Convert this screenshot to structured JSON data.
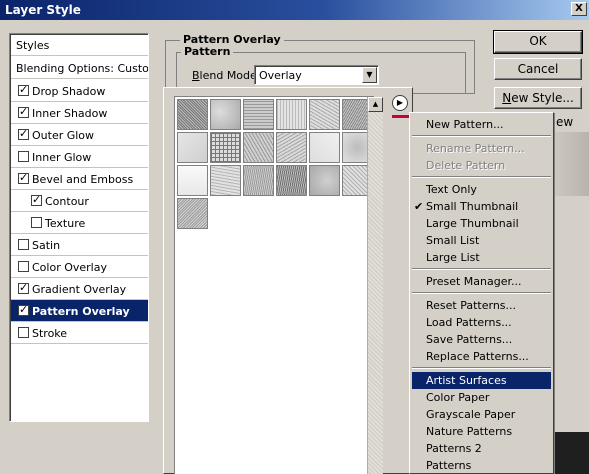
{
  "window": {
    "title": "Layer Style",
    "close_glyph": "X"
  },
  "styles_list": {
    "header": "Styles",
    "blending_options": "Blending Options: Custom",
    "items": [
      {
        "label": "Drop Shadow",
        "checked": true
      },
      {
        "label": "Inner Shadow",
        "checked": true
      },
      {
        "label": "Outer Glow",
        "checked": true
      },
      {
        "label": "Inner Glow",
        "checked": false
      },
      {
        "label": "Bevel and Emboss",
        "checked": true
      },
      {
        "label": "Contour",
        "checked": true,
        "indent": true
      },
      {
        "label": "Texture",
        "checked": false,
        "indent": true
      },
      {
        "label": "Satin",
        "checked": false
      },
      {
        "label": "Color Overlay",
        "checked": false
      },
      {
        "label": "Gradient Overlay",
        "checked": true
      },
      {
        "label": "Pattern Overlay",
        "checked": true,
        "selected": true
      },
      {
        "label": "Stroke",
        "checked": false
      }
    ]
  },
  "pattern_overlay": {
    "title": "Pattern Overlay",
    "group_title": "Pattern",
    "blend_mode_label": "lend Mode:",
    "blend_mode_accel": "B",
    "blend_mode_value": "Overlay"
  },
  "buttons": {
    "ok": "OK",
    "cancel": "Cancel",
    "new_style": "New Style...",
    "new_style_accel": "N",
    "new_style_rest": "ew Style..."
  },
  "preview": {
    "label": "ew"
  },
  "picker": {
    "tile_count": 19
  },
  "menu": {
    "items": [
      {
        "label": "New Pattern...",
        "state": "normal"
      },
      {
        "sep": true
      },
      {
        "label": "Rename Pattern...",
        "state": "disabled"
      },
      {
        "label": "Delete Pattern",
        "state": "disabled"
      },
      {
        "sep": true
      },
      {
        "label": "Text Only",
        "state": "normal"
      },
      {
        "label": "Small Thumbnail",
        "state": "checked"
      },
      {
        "label": "Large Thumbnail",
        "state": "normal"
      },
      {
        "label": "Small List",
        "state": "normal"
      },
      {
        "label": "Large List",
        "state": "normal"
      },
      {
        "sep": true
      },
      {
        "label": "Preset Manager...",
        "state": "normal"
      },
      {
        "sep": true
      },
      {
        "label": "Reset Patterns...",
        "state": "normal"
      },
      {
        "label": "Load Patterns...",
        "state": "normal"
      },
      {
        "label": "Save Patterns...",
        "state": "normal"
      },
      {
        "label": "Replace Patterns...",
        "state": "normal"
      },
      {
        "sep": true
      },
      {
        "label": "Artist Surfaces",
        "state": "highlight"
      },
      {
        "label": "Color Paper",
        "state": "normal"
      },
      {
        "label": "Grayscale Paper",
        "state": "normal"
      },
      {
        "label": "Nature Patterns",
        "state": "normal"
      },
      {
        "label": "Patterns 2",
        "state": "normal"
      },
      {
        "label": "Patterns",
        "state": "normal"
      }
    ]
  },
  "colors": {
    "selection": "#0a246a",
    "face": "#d4d0c8",
    "accent_underline": "#c4004a"
  }
}
